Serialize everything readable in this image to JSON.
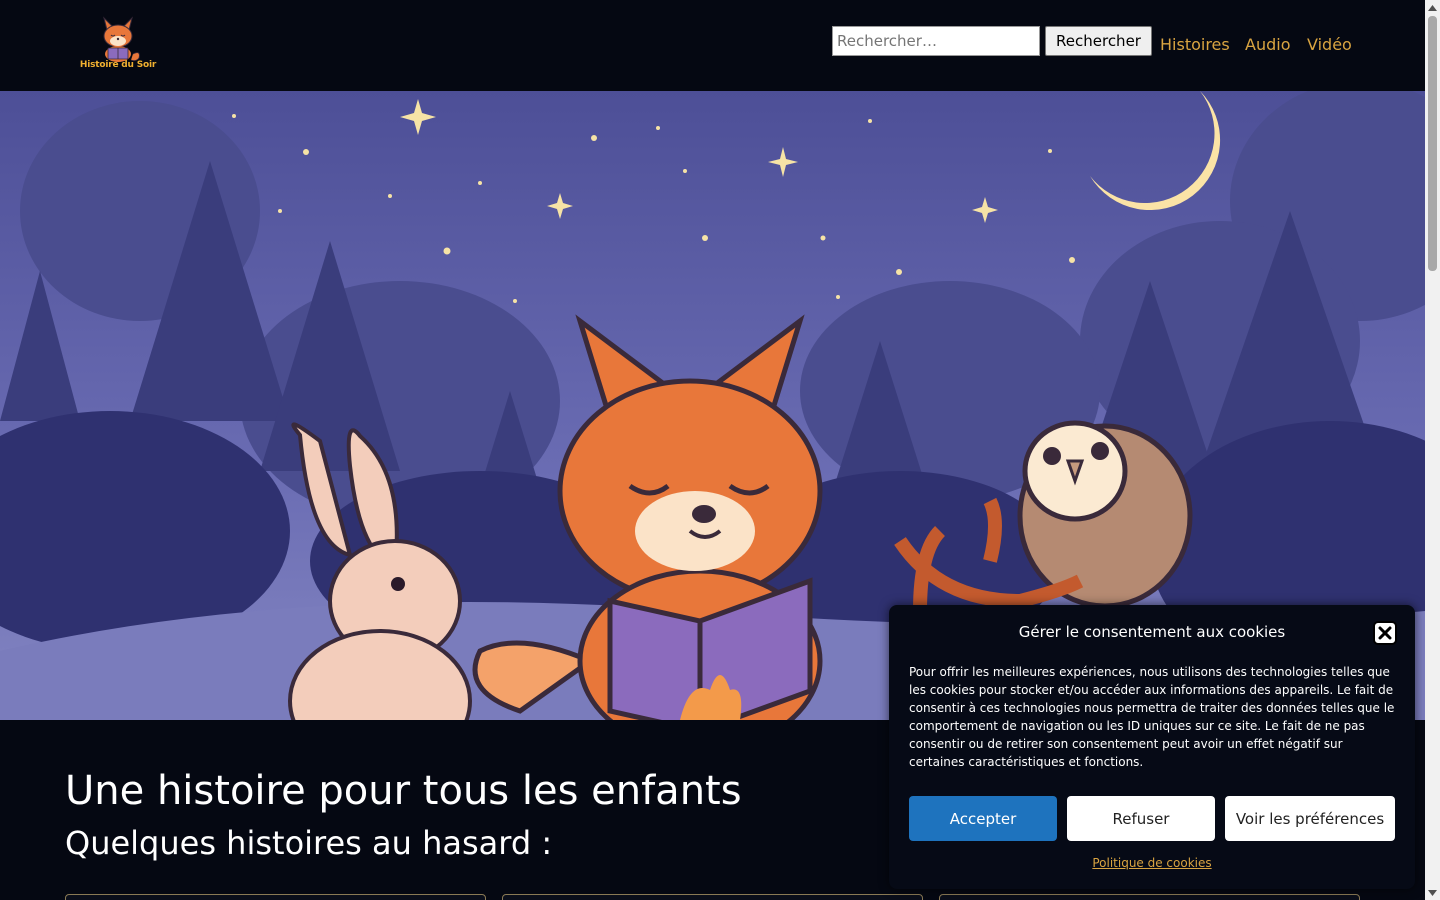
{
  "header": {
    "logo_text": "Histoire du Soir",
    "search_placeholder": "Rechercher…",
    "search_button": "Rechercher",
    "nav": [
      "Histoires",
      "Audio",
      "Vidéo"
    ]
  },
  "main": {
    "title": "Une histoire pour tous les enfants",
    "subtitle": "Quelques histoires au hasard :"
  },
  "cookie_banner": {
    "title": "Gérer le consentement aux cookies",
    "text": "Pour offrir les meilleures expériences, nous utilisons des technologies telles que les cookies pour stocker et/ou accéder aux informations des appareils. Le fait de consentir à ces technologies nous permettra de traiter des données telles que le comportement de navigation ou les ID uniques sur ce site. Le fait de ne pas consentir ou de retirer son consentement peut avoir un effet négatif sur certaines caractéristiques et fonctions.",
    "accept": "Accepter",
    "refuse": "Refuser",
    "preferences": "Voir les préférences",
    "policy_link": "Politique de cookies"
  },
  "colors": {
    "background": "#050812",
    "nav_link": "#d9a441",
    "accept_button": "#1e73be",
    "sky": "#5c60a6"
  },
  "icons": [
    "fox-logo-icon",
    "close-icon",
    "scroll-up-icon",
    "scroll-down-icon"
  ]
}
